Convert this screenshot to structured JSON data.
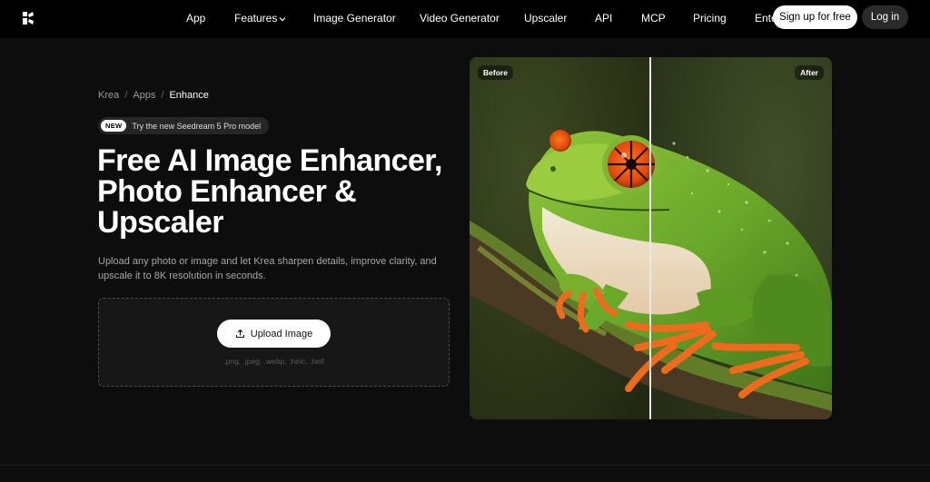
{
  "nav": {
    "items": [
      {
        "label": "App"
      },
      {
        "label": "Features"
      },
      {
        "label": "Image Generator"
      },
      {
        "label": "Video Generator"
      },
      {
        "label": "Upscaler"
      },
      {
        "label": "API"
      },
      {
        "label": "MCP"
      },
      {
        "label": "Pricing"
      },
      {
        "label": "Ente"
      }
    ],
    "signup_label": "Sign up for free",
    "login_label": "Log in"
  },
  "breadcrumb": {
    "items": [
      "Krea",
      "Apps",
      "Enhance"
    ],
    "separator": "/"
  },
  "promo": {
    "badge": "NEW",
    "text": "Try the new Seedream 5 Pro model"
  },
  "hero": {
    "title_line1": "Free AI Image Enhancer,",
    "title_line2": "Photo Enhancer &",
    "title_line3": "Upscaler",
    "subtitle": "Upload any photo or image and let Krea sharpen details, improve clarity, and upscale it to 8K resolution in seconds."
  },
  "upload": {
    "button_label": "Upload Image",
    "formats": ".png, .jpeg, .webp, .heic, .heif"
  },
  "compare": {
    "before_label": "Before",
    "after_label": "After",
    "split_fraction": 0.5
  }
}
